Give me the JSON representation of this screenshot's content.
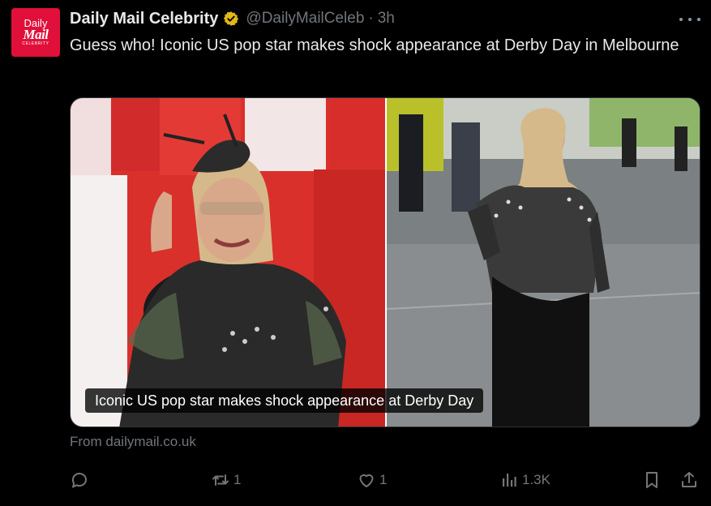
{
  "account": {
    "avatar_line1": "Daily",
    "avatar_line2": "Mail",
    "avatar_line3": "CELEBRITY",
    "display_name": "Daily Mail Celebrity",
    "handle": "@DailyMailCeleb",
    "separator": "·",
    "time": "3h",
    "verified_color": "#e2b719"
  },
  "tweet": {
    "text": "Guess who! Iconic US pop star makes shock appearance at Derby Day in Melbourne"
  },
  "card": {
    "caption": "Iconic US pop star makes shock appearance at Derby Day",
    "source": "From dailymail.co.uk"
  },
  "actions": {
    "reply_count": "",
    "retweet_count": "1",
    "like_count": "1",
    "views_count": "1.3K"
  },
  "colors": {
    "background": "#000000",
    "text": "#e7e9ea",
    "muted": "#71767b",
    "brand": "#e0103a"
  }
}
